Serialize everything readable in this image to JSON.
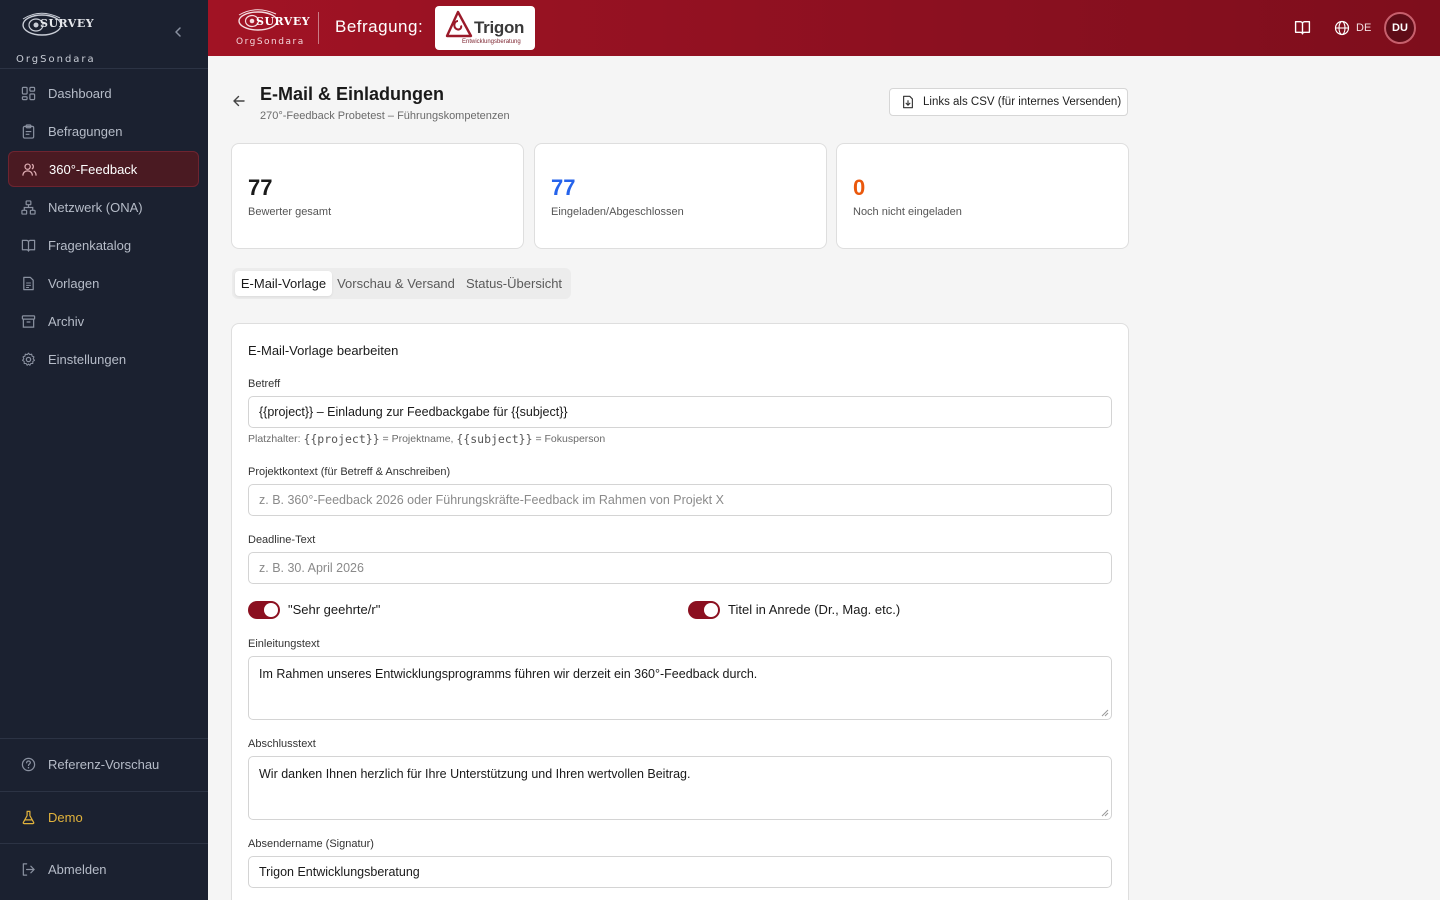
{
  "sidebar": {
    "logo_text": "SURVEY",
    "org_name": "OrgSondara",
    "items": [
      {
        "label": "Dashboard",
        "icon": "dashboard-icon"
      },
      {
        "label": "Befragungen",
        "icon": "clipboard-icon"
      },
      {
        "label": "360°-Feedback",
        "icon": "users-icon",
        "active": true
      },
      {
        "label": "Netzwerk (ONA)",
        "icon": "network-icon"
      },
      {
        "label": "Fragenkatalog",
        "icon": "book-icon"
      },
      {
        "label": "Vorlagen",
        "icon": "file-icon"
      },
      {
        "label": "Archiv",
        "icon": "archive-icon"
      },
      {
        "label": "Einstellungen",
        "icon": "gear-icon"
      }
    ],
    "reference_preview": "Referenz-Vorschau",
    "demo": "Demo",
    "logout": "Abmelden"
  },
  "header": {
    "logo_text": "SURVEY",
    "org_name": "OrgSondara",
    "survey_label": "Befragung:",
    "client_name": "Trigon",
    "client_sub": "Entwicklungsberatung",
    "language": "DE",
    "avatar_initials": "DU"
  },
  "page": {
    "title": "E-Mail & Einladungen",
    "subtitle": "270°-Feedback Probetest – Führungskompetenzen",
    "csv_button": "Links als CSV (für internes Versenden)"
  },
  "stats": [
    {
      "value": "77",
      "label": "Bewerter gesamt",
      "color": "#1a1a1a"
    },
    {
      "value": "77",
      "label": "Eingeladen/Abgeschlossen",
      "color": "#2563eb"
    },
    {
      "value": "0",
      "label": "Noch nicht eingeladen",
      "color": "#ea580c"
    }
  ],
  "tabs": [
    {
      "label": "E-Mail-Vorlage",
      "active": true
    },
    {
      "label": "Vorschau & Versand",
      "active": false
    },
    {
      "label": "Status-Übersicht",
      "active": false
    }
  ],
  "form": {
    "card_title": "E-Mail-Vorlage bearbeiten",
    "subject_label": "Betreff",
    "subject_value": "{{project}} – Einladung zur Feedbackgabe für {{subject}}",
    "hint_prefix": "Platzhalter: ",
    "hint_project_code": "{{project}}",
    "hint_project_text": " = Projektname, ",
    "hint_subject_code": "{{subject}}",
    "hint_subject_text": " = Fokusperson",
    "context_label": "Projektkontext (für Betreff & Anschreiben)",
    "context_placeholder": "z. B. 360°-Feedback 2026 oder Führungskräfte-Feedback im Rahmen von Projekt X",
    "deadline_label": "Deadline-Text",
    "deadline_placeholder": "z. B. 30. April 2026",
    "toggle_salutation_label": "\"Sehr geehrte/r\"",
    "toggle_salutation_on": true,
    "toggle_title_label": "Titel in Anrede (Dr., Mag. etc.)",
    "toggle_title_on": true,
    "intro_label": "Einleitungstext",
    "intro_value": "Im Rahmen unseres Entwicklungsprogramms führen wir derzeit ein 360°-Feedback durch.",
    "closing_label": "Abschlusstext",
    "closing_value": "Wir danken Ihnen herzlich für Ihre Unterstützung und Ihren wertvollen Beitrag.",
    "sender_label": "Absendername (Signatur)",
    "sender_value": "Trigon Entwicklungsberatung"
  },
  "colors": {
    "brand": "#a11324",
    "sidebar_bg": "#1b2130",
    "active_item_bg": "#4a1a22",
    "demo": "#e2b33c"
  }
}
